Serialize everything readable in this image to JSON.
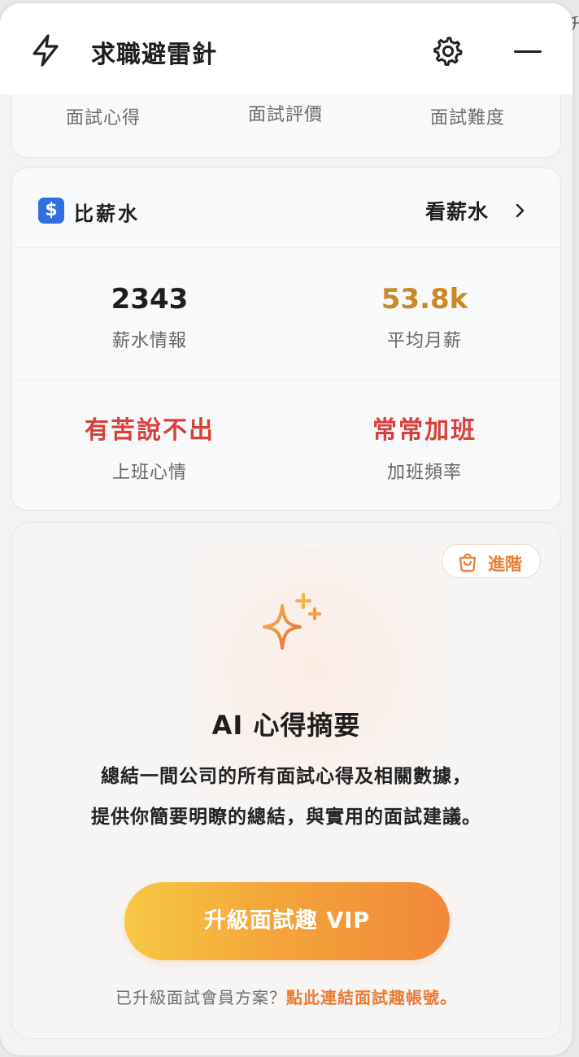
{
  "edge_text": "升",
  "header": {
    "title": "求職避雷針",
    "icons": {
      "left": "bolt-icon",
      "settings": "gear-icon",
      "minimize": "minimize-icon"
    }
  },
  "top_tabs": [
    "面試心得",
    "面試評價",
    "面試難度"
  ],
  "salary": {
    "icon_glyph": "$",
    "title": "比薪水",
    "link_label": "看薪水",
    "link_chevron": "›",
    "stats": [
      {
        "value": "2343",
        "label": "薪水情報"
      },
      {
        "value": "53.8k",
        "label": "平均月薪"
      },
      {
        "value": "有苦說不出",
        "label": "上班心情"
      },
      {
        "value": "常常加班",
        "label": "加班頻率"
      }
    ]
  },
  "ai_summary": {
    "badge_label": "進階",
    "badge_icon": "bag-icon",
    "hero_icon": "sparkle-icon",
    "title": "AI 心得摘要",
    "description_line1": "總結一間公司的所有面試心得及相關數據，",
    "description_line2": "提供你簡要明瞭的總結，與實用的面試建議。",
    "cta_label": "升級面試趣 VIP",
    "footer_plain": "已升級面試會員方案？",
    "footer_link": "點此連結面試趣帳號。"
  },
  "colors": {
    "accent_orange": "#ee7b35",
    "gold": "#c98a26",
    "red": "#d9403a",
    "blue": "#2f6fe0"
  }
}
